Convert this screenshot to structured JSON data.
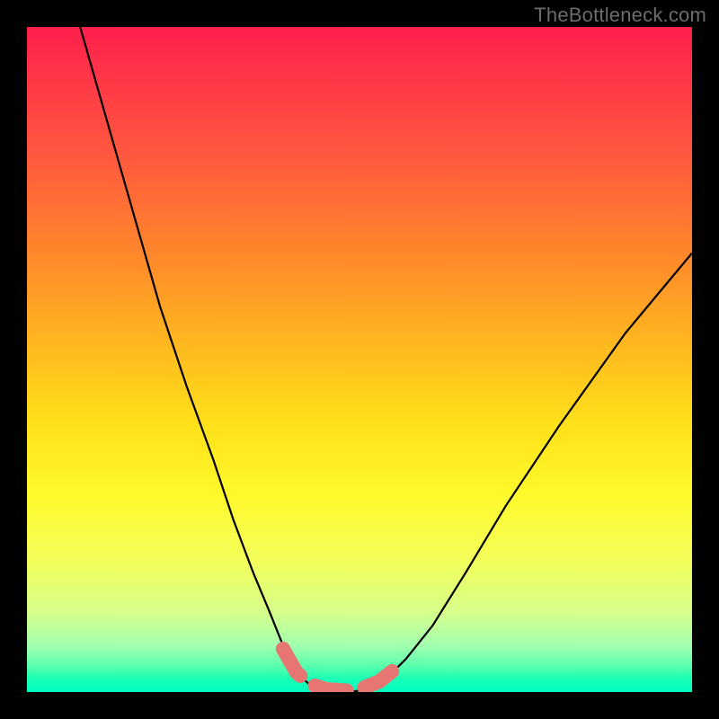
{
  "watermark": "TheBottleneck.com",
  "chart_data": {
    "type": "line",
    "title": "",
    "xlabel": "",
    "ylabel": "",
    "x_range": [
      0,
      100
    ],
    "y_range": [
      0,
      100
    ],
    "background_scalar_field": {
      "description": "vertical gradient",
      "stops": [
        {
          "pos": 0,
          "color": "#ff1f4c"
        },
        {
          "pos": 60,
          "color": "#ffe11a"
        },
        {
          "pos": 100,
          "color": "#00ffc0"
        }
      ]
    },
    "series": [
      {
        "name": "curve",
        "stroke": "#000000",
        "stroke_width": 2,
        "points_xy": [
          [
            8,
            100
          ],
          [
            12,
            86
          ],
          [
            16,
            72
          ],
          [
            20,
            58
          ],
          [
            24,
            46
          ],
          [
            28,
            35
          ],
          [
            31,
            26
          ],
          [
            34,
            18
          ],
          [
            36.5,
            12
          ],
          [
            38.5,
            7
          ],
          [
            40,
            4
          ],
          [
            41.5,
            2
          ],
          [
            43,
            0.7
          ],
          [
            44.5,
            0.2
          ],
          [
            46,
            0
          ],
          [
            48,
            0
          ],
          [
            50,
            0.2
          ],
          [
            52,
            0.8
          ],
          [
            54,
            2
          ],
          [
            57,
            5
          ],
          [
            61,
            10
          ],
          [
            66,
            18
          ],
          [
            72,
            28
          ],
          [
            80,
            40
          ],
          [
            90,
            54
          ],
          [
            100,
            66
          ]
        ]
      },
      {
        "name": "highlight-segment",
        "stroke": "#e77672",
        "stroke_width": 14,
        "linecap": "round",
        "dash": "34 18",
        "points_xy": [
          [
            38.5,
            6.5
          ],
          [
            40.5,
            3
          ],
          [
            42.5,
            1.2
          ],
          [
            45,
            0.4
          ],
          [
            48,
            0.2
          ],
          [
            50.5,
            0.6
          ],
          [
            53,
            1.6
          ],
          [
            55,
            3.2
          ]
        ]
      }
    ]
  }
}
